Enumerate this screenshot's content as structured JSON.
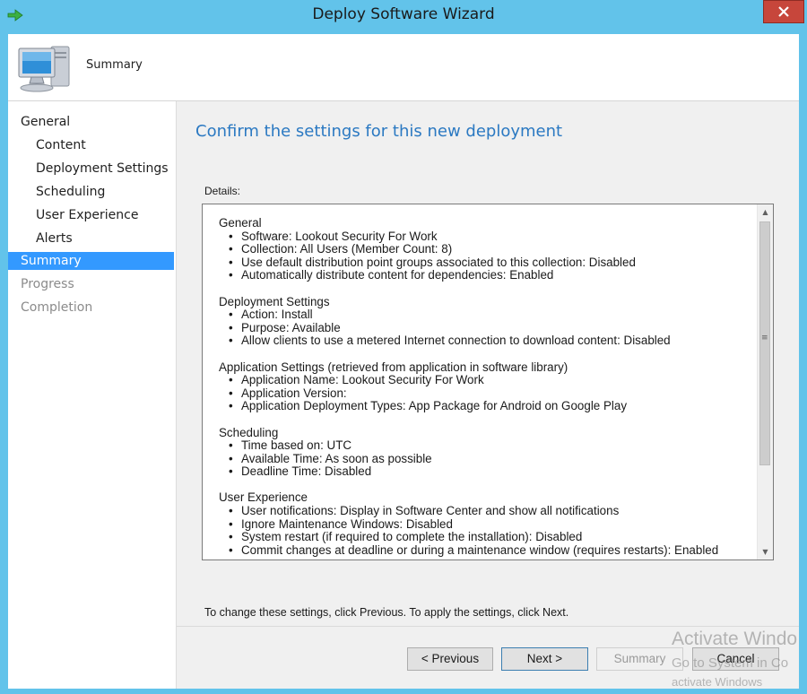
{
  "window": {
    "title": "Deploy Software Wizard",
    "close_icon": "close-x-icon",
    "accent_color": "#62c3ea"
  },
  "header": {
    "title": "Summary",
    "icon": "computer-monitor-icon"
  },
  "nav": {
    "items": [
      {
        "label": "General",
        "state": "normal"
      },
      {
        "label": "Content",
        "state": "normal"
      },
      {
        "label": "Deployment Settings",
        "state": "normal"
      },
      {
        "label": "Scheduling",
        "state": "normal"
      },
      {
        "label": "User Experience",
        "state": "normal"
      },
      {
        "label": "Alerts",
        "state": "normal"
      },
      {
        "label": "Summary",
        "state": "active"
      },
      {
        "label": "Progress",
        "state": "disabled"
      },
      {
        "label": "Completion",
        "state": "disabled"
      }
    ],
    "active_color": "#3399ff"
  },
  "main": {
    "heading": "Confirm the settings for this new deployment",
    "details_label": "Details:",
    "details": [
      {
        "title": "General",
        "items": [
          "Software: Lookout Security For Work",
          "Collection: All Users (Member Count: 8)",
          "Use default distribution point groups associated to this collection: Disabled",
          "Automatically distribute content for dependencies: Enabled"
        ]
      },
      {
        "title": "Deployment Settings",
        "items": [
          "Action: Install",
          "Purpose: Available",
          "Allow clients to use a metered Internet connection to download content: Disabled"
        ]
      },
      {
        "title": "Application Settings (retrieved from application in software library)",
        "items": [
          "Application Name: Lookout Security For Work",
          "Application Version:",
          "Application Deployment Types: App Package for Android on Google Play"
        ]
      },
      {
        "title": "Scheduling",
        "items": [
          "Time based on: UTC",
          "Available Time: As soon as possible",
          "Deadline Time: Disabled"
        ]
      },
      {
        "title": "User Experience",
        "items": [
          "User notifications: Display in Software Center and show all notifications",
          "Ignore Maintenance Windows: Disabled",
          "System restart  (if required to complete the installation): Disabled",
          "Commit changes at deadline or during a maintenance window (requires restarts): Enabled"
        ]
      }
    ],
    "hint": "To change these settings, click Previous. To apply the settings, click Next."
  },
  "buttons": {
    "previous": "< Previous",
    "next": "Next >",
    "summary": "Summary",
    "cancel": "Cancel"
  },
  "watermark": {
    "line1": "Activate Windo",
    "line2": "Go to System in Co",
    "line3": "activate Windows"
  }
}
